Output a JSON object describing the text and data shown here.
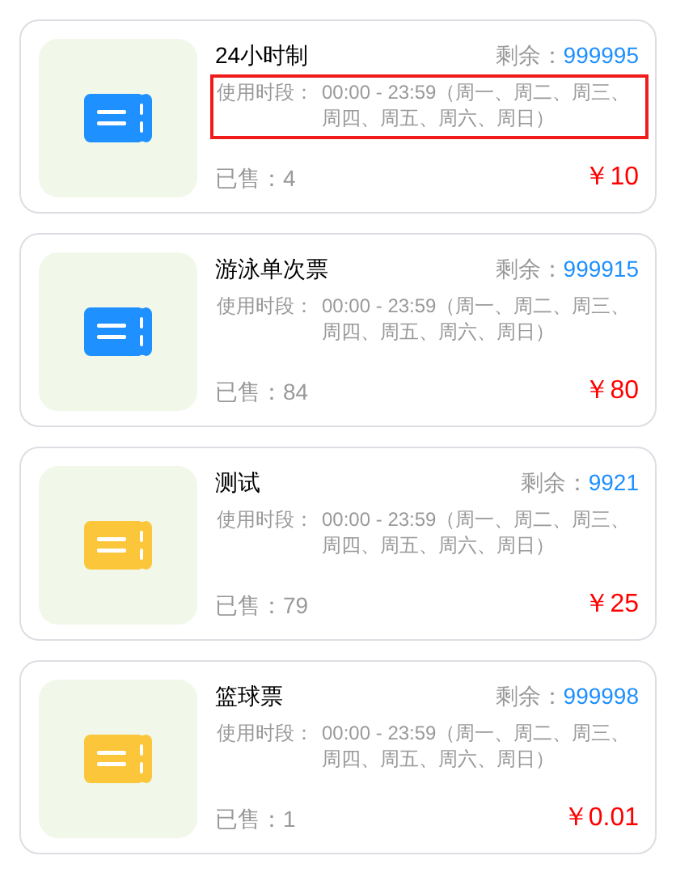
{
  "tickets": [
    {
      "name": "24小时制",
      "remaining_label": "剩余：",
      "remaining": "999995",
      "period_label": "使用时段：",
      "period": "00:00 - 23:59（周一、周二、周三、周四、周五、周六、周日）",
      "highlighted": true,
      "sold": "已售：4",
      "price": "￥10",
      "color": "#1e90ff"
    },
    {
      "name": "游泳单次票",
      "remaining_label": "剩余：",
      "remaining": "999915",
      "period_label": "使用时段：",
      "period": "00:00 - 23:59（周一、周二、周三、周四、周五、周六、周日）",
      "highlighted": false,
      "sold": "已售：84",
      "price": "￥80",
      "color": "#1e90ff"
    },
    {
      "name": "测试",
      "remaining_label": "剩余：",
      "remaining": "9921",
      "period_label": "使用时段：",
      "period": "00:00 - 23:59（周一、周二、周三、周四、周五、周六、周日）",
      "highlighted": false,
      "sold": "已售：79",
      "price": "￥25",
      "color": "#fcc63a"
    },
    {
      "name": "篮球票",
      "remaining_label": "剩余：",
      "remaining": "999998",
      "period_label": "使用时段：",
      "period": "00:00 - 23:59（周一、周二、周三、周四、周五、周六、周日）",
      "highlighted": false,
      "sold": "已售：1",
      "price": "￥0.01",
      "color": "#fcc63a"
    }
  ]
}
